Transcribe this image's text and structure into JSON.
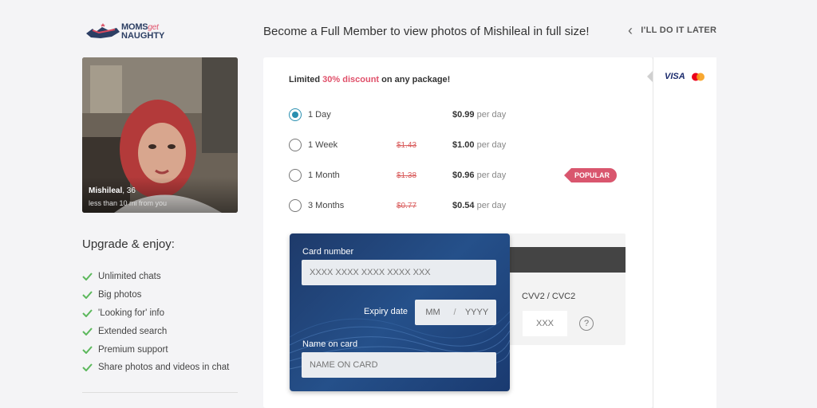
{
  "brand": {
    "line1": "MOMS",
    "line1_italic": "get",
    "line2": "NAUGHTY"
  },
  "header": {
    "headline": "Become a Full Member to view photos of Mishileal in full size!",
    "later_label": "I'LL DO IT LATER"
  },
  "profile": {
    "name": "Mishileal",
    "age": ", 36",
    "distance": "less than 10 mi from you"
  },
  "perks": {
    "title": "Upgrade & enjoy:",
    "items": [
      "Unlimited chats",
      "Big photos",
      "'Looking for' info",
      "Extended search",
      "Premium support",
      "Share photos and videos in chat"
    ]
  },
  "promo": {
    "prefix": "Limited ",
    "percent": "30% discount",
    "suffix": " on any package!"
  },
  "plans": [
    {
      "label": "1 Day",
      "old_price": "",
      "price": "$0.99",
      "per": " per day",
      "selected": true,
      "badge": ""
    },
    {
      "label": "1 Week",
      "old_price": "$1.43",
      "price": "$1.00",
      "per": " per day",
      "selected": false,
      "badge": ""
    },
    {
      "label": "1 Month",
      "old_price": "$1.38",
      "price": "$0.96",
      "per": " per day",
      "selected": false,
      "badge": "POPULAR"
    },
    {
      "label": "3 Months",
      "old_price": "$0.77",
      "price": "$0.54",
      "per": " per day",
      "selected": false,
      "badge": ""
    }
  ],
  "payment": {
    "visa": "VISA"
  },
  "card": {
    "number_label": "Card number",
    "number_placeholder": "XXXX XXXX XXXX XXXX XXX",
    "expiry_label": "Expiry date",
    "mm": "MM",
    "sep": "/",
    "yyyy": "YYYY",
    "name_label": "Name on card",
    "name_placeholder": "NAME ON CARD",
    "cvv_label": "CVV2 / CVC2",
    "cvv_placeholder": "XXX",
    "help": "?"
  },
  "colors": {
    "accent": "#2a8fb0",
    "discount": "#e0506a",
    "badge": "#d9566e",
    "card": "#1e3a6a"
  }
}
